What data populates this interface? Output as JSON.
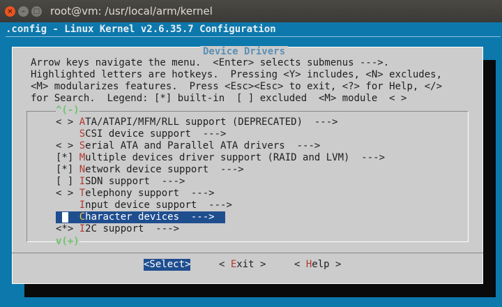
{
  "window": {
    "title": "root@vm: /usr/local/arm/kernel",
    "close": "×",
    "minimize": "–",
    "maximize": "□"
  },
  "header": ".config - Linux Kernel v2.6.35.7 Configuration",
  "dialog": {
    "title": "Device Drivers",
    "help": [
      "Arrow keys navigate the menu.  <Enter> selects submenus --->.",
      "Highlighted letters are hotkeys.  Pressing <Y> includes, <N> excludes,",
      "<M> modularizes features.  Press <Esc><Esc> to exit, <?> for Help, </>",
      "for Search.  Legend: [*] built-in  [ ] excluded  <M> module  < >"
    ]
  },
  "menu": {
    "scroll_up": "^(-)",
    "scroll_down": "v(+)",
    "items": [
      {
        "prefix": "< > ",
        "hot": "A",
        "rest": "TA/ATAPI/MFM/RLL support (DEPRECATED)  --->"
      },
      {
        "prefix": "    ",
        "hot": "S",
        "rest": "CSI device support  --->"
      },
      {
        "prefix": "< > ",
        "hot": "S",
        "rest": "erial ATA and Parallel ATA drivers  --->"
      },
      {
        "prefix": "[*] ",
        "hot": "M",
        "rest": "ultiple devices driver support (RAID and LVM)  --->"
      },
      {
        "prefix": "[*] ",
        "hot": "N",
        "rest": "etwork device support  --->"
      },
      {
        "prefix": "[ ] ",
        "hot": "I",
        "rest": "SDN support  --->"
      },
      {
        "prefix": "< > ",
        "hot": "T",
        "rest": "elephony support  --->"
      },
      {
        "prefix": "    ",
        "hot": "I",
        "rest": "nput device support  --->"
      },
      {
        "prefix": "    ",
        "hot": "C",
        "rest": "haracter devices  --->"
      },
      {
        "prefix": "<*> ",
        "hot": "I",
        "rest": "2C support  --->"
      }
    ],
    "selected_index": 8
  },
  "buttons": {
    "select": "<Select>",
    "exit_left": "< ",
    "exit_hot": "E",
    "exit_rest": "xit >",
    "help_left": "< ",
    "help_hot": "H",
    "help_rest": "elp >"
  },
  "colors": {
    "terminal_bg": "#0d78ac",
    "dialog_bg": "#cccccc",
    "hotkey": "#b03a2e",
    "selection_bg": "#1f4e8f",
    "scroll_indicator": "#6ec46e"
  }
}
